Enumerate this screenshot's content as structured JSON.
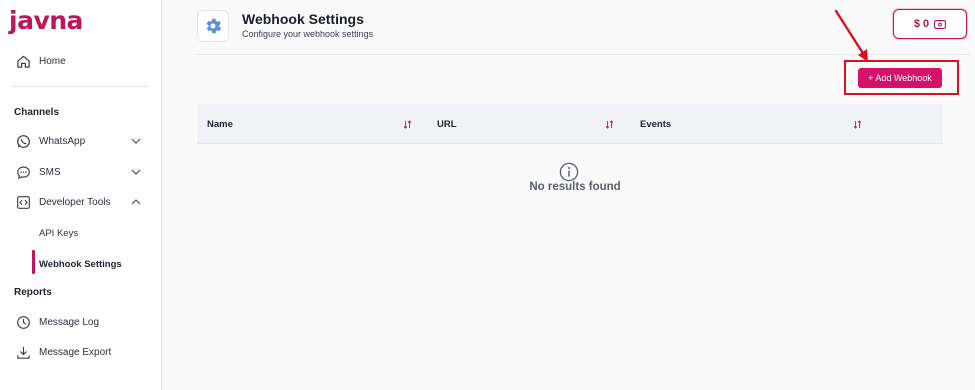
{
  "app": {
    "logo": "javna"
  },
  "sidebar": {
    "home": "Home",
    "channels_title": "Channels",
    "whatsapp": "WhatsApp",
    "sms": "SMS",
    "developer_tools": "Developer Tools",
    "api_keys": "API Keys",
    "webhook_settings": "Webhook Settings",
    "reports_title": "Reports",
    "message_log": "Message Log",
    "message_export": "Message Export"
  },
  "header": {
    "title": "Webhook Settings",
    "subtitle": "Configure your webhook settings",
    "balance": "$ 0"
  },
  "actions": {
    "add_webhook": "+ Add Webhook"
  },
  "table": {
    "columns": [
      "Name",
      "URL",
      "Events"
    ],
    "empty_message": "No results found"
  },
  "colors": {
    "brand": "#c0155a",
    "button": "#d5126a",
    "annotation": "#d8121c"
  },
  "icons": [
    "home-icon",
    "whatsapp-icon",
    "sms-icon",
    "code-icon",
    "clock-icon",
    "download-icon",
    "gear-icon",
    "wallet-icon",
    "sort-icon",
    "info-icon"
  ]
}
